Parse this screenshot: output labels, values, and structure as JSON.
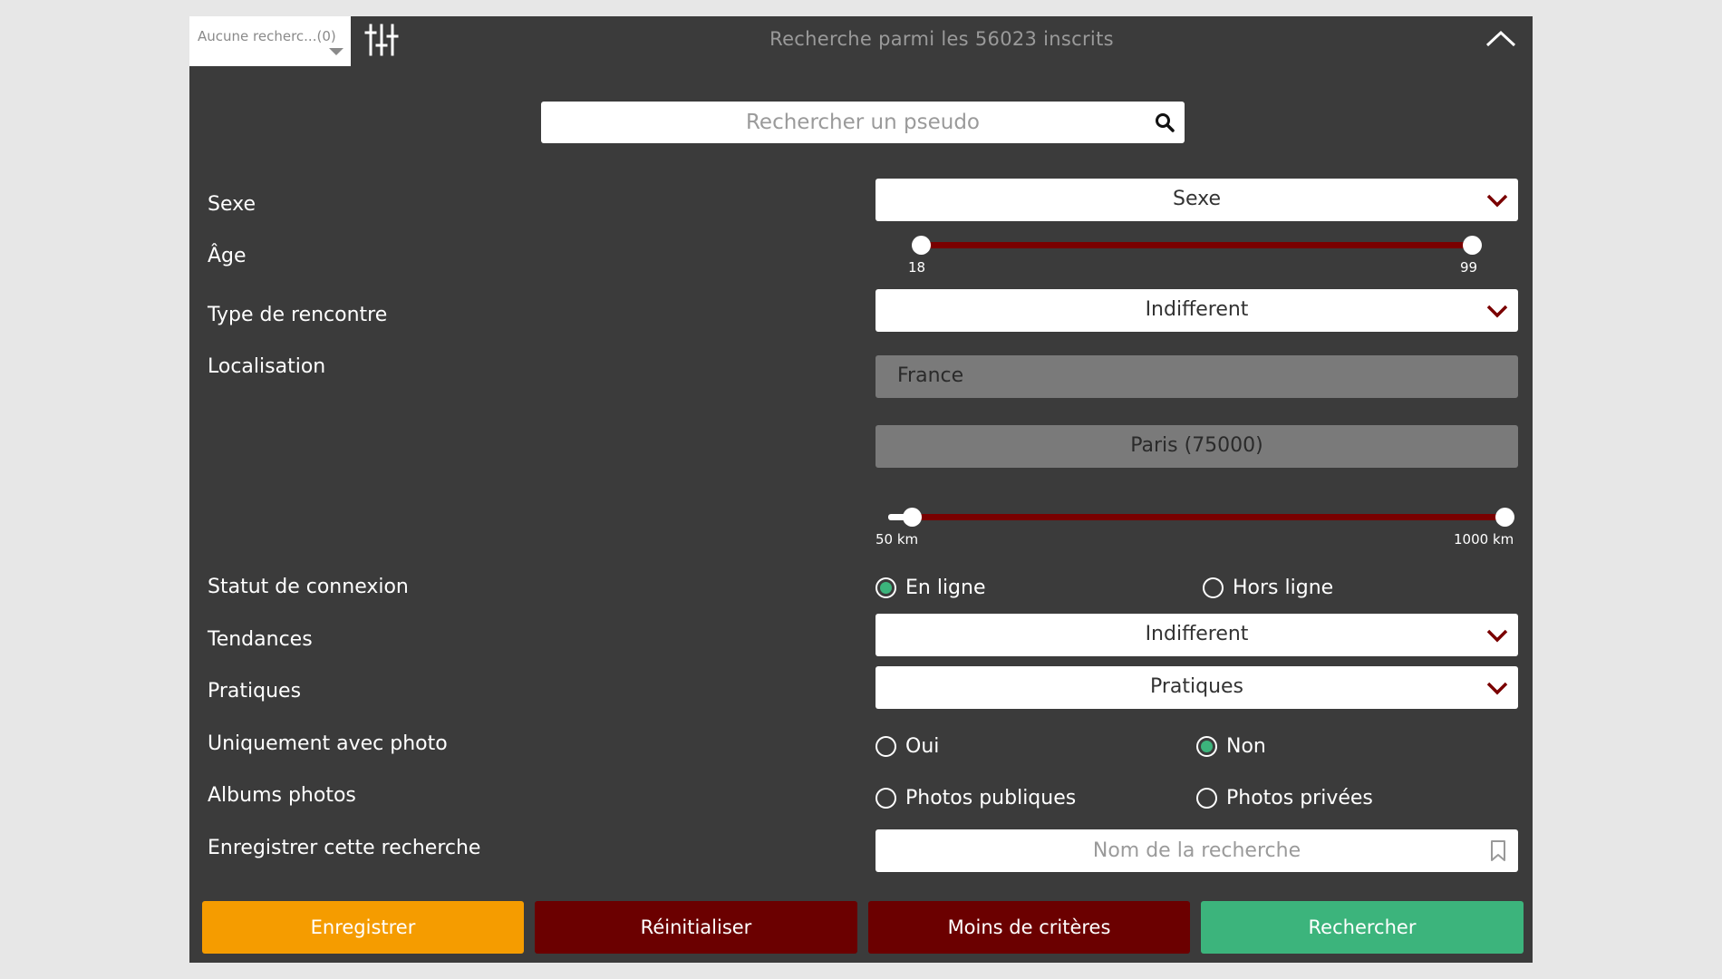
{
  "header": {
    "saved_search_select": "Aucune recherc...(0)",
    "title": "Recherche parmi les 56023 inscrits"
  },
  "pseudo_search": {
    "placeholder": "Rechercher un pseudo"
  },
  "fields": {
    "sexe": {
      "label": "Sexe",
      "value": "Sexe"
    },
    "age": {
      "label": "Âge",
      "min_label": "18",
      "max_label": "99",
      "min": 18,
      "max": 99
    },
    "type_rencontre": {
      "label": "Type de rencontre",
      "value": "Indifferent"
    },
    "localisation": {
      "label": "Localisation",
      "country": "France",
      "city": "Paris (75000)",
      "distance_min_label": "50 km",
      "distance_max_label": "1000 km"
    },
    "statut_connexion": {
      "label": "Statut de connexion",
      "option_online": "En ligne",
      "option_offline": "Hors ligne",
      "selected": "En ligne"
    },
    "tendances": {
      "label": "Tendances",
      "value": "Indifferent"
    },
    "pratiques": {
      "label": "Pratiques",
      "value": "Pratiques"
    },
    "uniquement_photo": {
      "label": "Uniquement avec photo",
      "option_yes": "Oui",
      "option_no": "Non",
      "selected": "Non"
    },
    "albums_photos": {
      "label": "Albums photos",
      "option_public": "Photos publiques",
      "option_private": "Photos privées"
    },
    "enregistrer_recherche": {
      "label": "Enregistrer cette recherche",
      "placeholder": "Nom de la recherche"
    }
  },
  "buttons": {
    "save": "Enregistrer",
    "reset": "Réinitialiser",
    "fewer": "Moins de critères",
    "search": "Rechercher"
  },
  "colors": {
    "panel": "#3b3b3b",
    "save": "#f59c00",
    "reset": "#6b0000",
    "search": "#3cb47c",
    "slider": "#7a0000",
    "radio_active": "#3cb47c"
  }
}
